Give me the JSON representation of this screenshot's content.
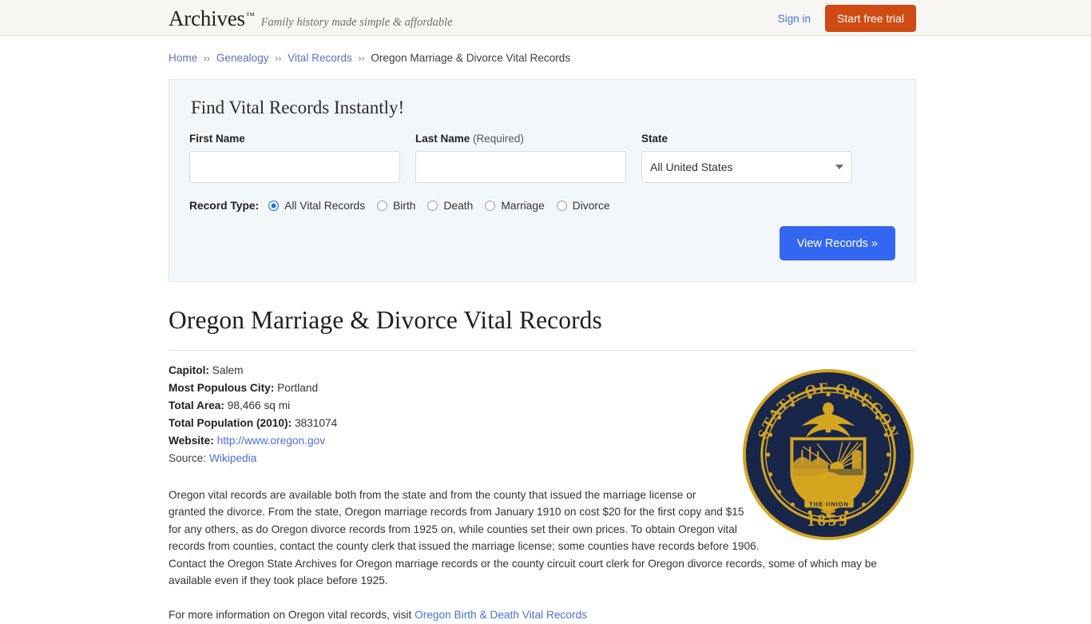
{
  "header": {
    "brand_name": "Archives",
    "brand_tm": "™",
    "tagline": "Family history made simple & affordable",
    "sign_in_label": "Sign in",
    "trial_button_label": "Start free trial",
    "accent_orange": "#cf4b13",
    "link_blue": "#4a6fe0",
    "background": "#f7f6f2"
  },
  "breadcrumb": {
    "separator": "››",
    "items": [
      {
        "label": "Home",
        "link": true
      },
      {
        "label": "Genealogy",
        "link": true
      },
      {
        "label": "Vital Records",
        "link": true
      },
      {
        "label": "Oregon Marriage & Divorce Vital Records",
        "link": false
      }
    ]
  },
  "search_panel": {
    "title": "Find Vital Records Instantly!",
    "first_name": {
      "label": "First Name",
      "value": "",
      "placeholder": ""
    },
    "last_name": {
      "label": "Last Name",
      "required_note": "(Required)",
      "value": "",
      "placeholder": ""
    },
    "state": {
      "label": "State",
      "selected": "All United States"
    },
    "record_type": {
      "label": "Record Type:",
      "options": [
        {
          "label": "All Vital Records",
          "checked": true
        },
        {
          "label": "Birth",
          "checked": false
        },
        {
          "label": "Death",
          "checked": false
        },
        {
          "label": "Marriage",
          "checked": false
        },
        {
          "label": "Divorce",
          "checked": false
        }
      ]
    },
    "submit_label": "View Records »",
    "submit_color": "#3367f2",
    "panel_background": "#f4f7fa"
  },
  "article": {
    "title": "Oregon Marriage & Divorce Vital Records",
    "facts": [
      {
        "key": "Capitol:",
        "value": "Salem",
        "link": false
      },
      {
        "key": "Most Populous City:",
        "value": "Portland",
        "link": false
      },
      {
        "key": "Total Area:",
        "value": "98,466 sq mi",
        "link": false
      },
      {
        "key": "Total Population (2010):",
        "value": "3831074",
        "link": false
      },
      {
        "key": "Website:",
        "value": "http://www.oregon.gov",
        "link": true
      }
    ],
    "source_label": "Source:",
    "source_link": "Wikipedia",
    "paragraph": "Oregon vital records are available both from the state and from the county that issued the marriage license or granted the divorce. From the state, Oregon marriage records from January 1910 on cost $20 for the first copy and $15 for any others, as do Oregon divorce records from 1925 on, while counties set their own prices. To obtain Oregon vital records from counties, contact the county clerk that issued the marriage license; some counties have records before 1906. Contact the Oregon State Archives for Oregon marriage records or the county circuit court clerk for Oregon divorce records, some of which may be available even if they took place before 1925.",
    "footer_text": "For more information on Oregon vital records, visit ",
    "footer_link": "Oregon Birth & Death Vital Records"
  },
  "seal": {
    "name": "oregon-state-seal",
    "top_text": "STATE OF OREGON",
    "top_words": [
      "STATE",
      "OF",
      "OREGON"
    ],
    "year": "1859",
    "banner_text": "THE UNION",
    "navy": "#18264a",
    "gold": "#d6a520"
  }
}
